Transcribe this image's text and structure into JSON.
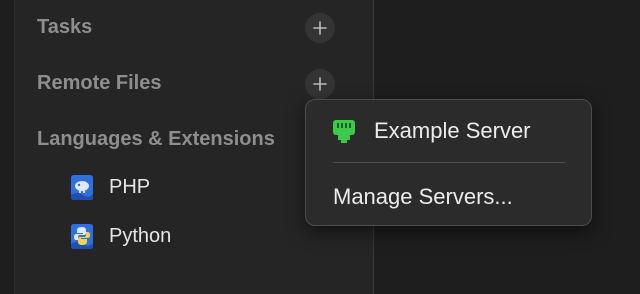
{
  "sidebar": {
    "sections": [
      {
        "title": "Tasks",
        "add_label": "+"
      },
      {
        "title": "Remote Files",
        "add_label": "+"
      },
      {
        "title": "Languages & Extensions"
      }
    ],
    "languages": [
      {
        "label": "PHP",
        "icon": "php-icon"
      },
      {
        "label": "Python",
        "icon": "python-icon"
      }
    ]
  },
  "popup_menu": {
    "items": [
      {
        "label": "Example Server",
        "icon": "server-icon",
        "icon_color": "#3ec94d"
      },
      {
        "label": "Manage Servers..."
      }
    ]
  },
  "colors": {
    "background": "#1e1e1e",
    "sidebar": "#252525",
    "section_title": "#8e8e8e",
    "popup": "#2b2b2b",
    "language_icon": "#2f6fe0"
  }
}
